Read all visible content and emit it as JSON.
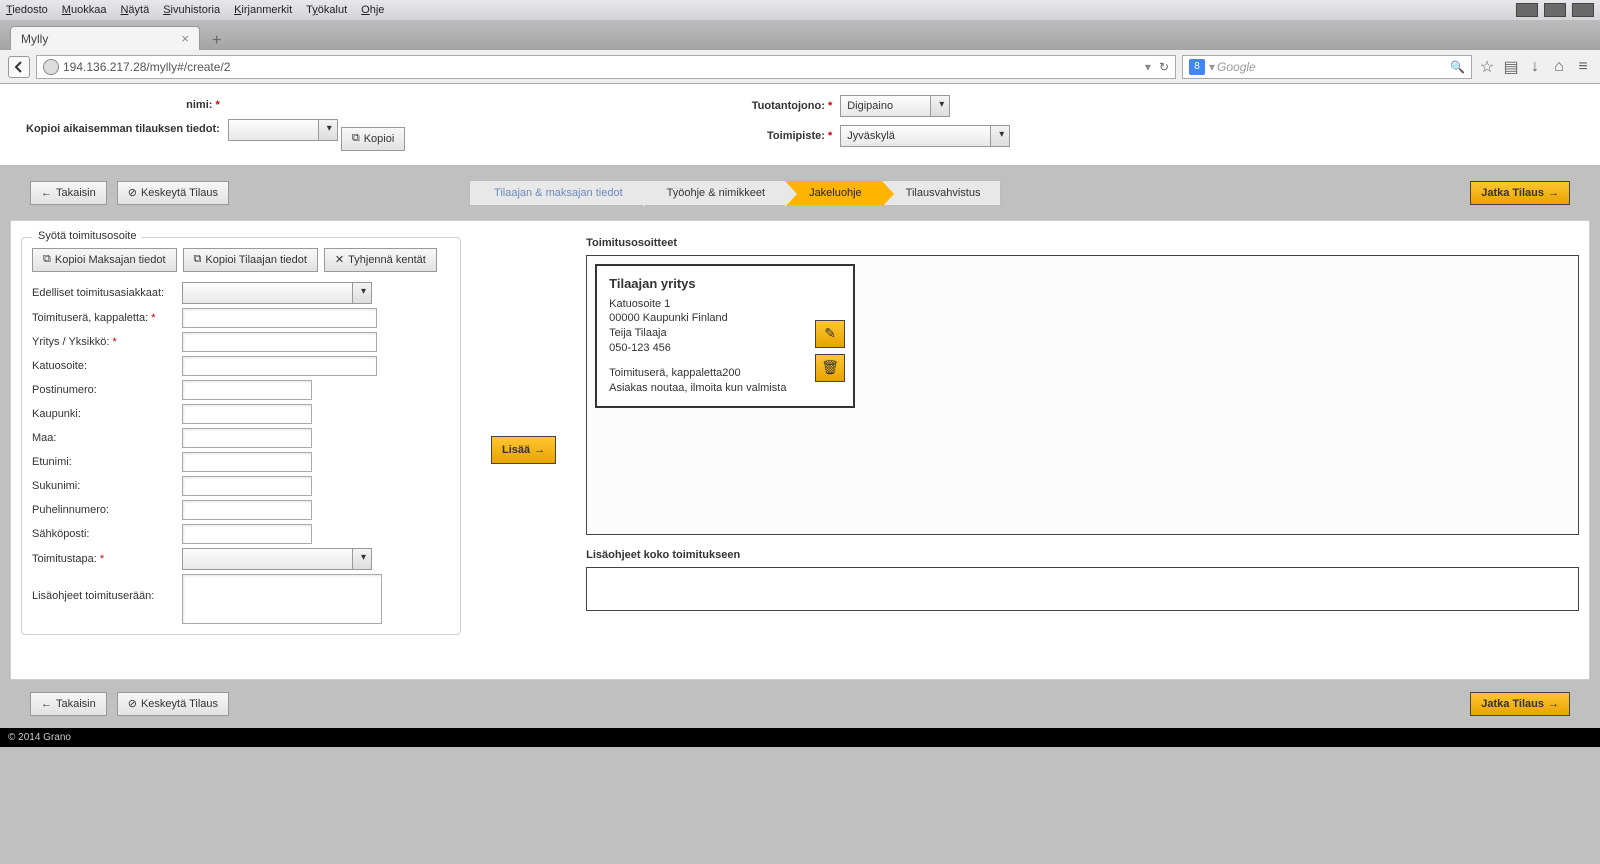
{
  "menubar": [
    "Tiedosto",
    "Muokkaa",
    "Näytä",
    "Sivuhistoria",
    "Kirjanmerkit",
    "Työkalut",
    "Ohje"
  ],
  "tab_title": "Mylly",
  "url": "194.136.217.28/mylly#/create/2",
  "search_placeholder": "Google",
  "top": {
    "nimi_label": "nimi:",
    "kopioi_aik_label": "Kopioi aikaisemman tilauksen tiedot:",
    "kopioi_btn": "Kopioi",
    "tuotantojono_label": "Tuotantojono:",
    "tuotantojono_value": "Digipaino",
    "toimipiste_label": "Toimipiste:",
    "toimipiste_value": "Jyväskylä"
  },
  "actions": {
    "back": "Takaisin",
    "cancel": "Keskeytä Tilaus",
    "continue": "Jatka Tilaus"
  },
  "wizard": [
    {
      "label": "Tilaajan & maksajan tiedot",
      "state": "done"
    },
    {
      "label": "Työohje & nimikkeet",
      "state": "norm"
    },
    {
      "label": "Jakeluohje",
      "state": "active"
    },
    {
      "label": "Tilausvahvistus",
      "state": "norm"
    }
  ],
  "leftform": {
    "title": "Syötä toimitusosoite",
    "btn_kopioi_maksajan": "Kopioi Maksajan tiedot",
    "btn_kopioi_tilaajan": "Kopioi Tilaajan tiedot",
    "btn_tyhjenna": "Tyhjennä kentät",
    "fields": {
      "edelliset": "Edelliset toimitusasiakkaat:",
      "toimitusera": "Toimituserä, kappaletta:",
      "yritys": "Yritys / Yksikkö:",
      "katuosoite": "Katuosoite:",
      "postinumero": "Postinumero:",
      "kaupunki": "Kaupunki:",
      "maa": "Maa:",
      "etunimi": "Etunimi:",
      "sukunimi": "Sukunimi:",
      "puhelin": "Puhelinnumero:",
      "sahkoposti": "Sähköposti:",
      "toimitustapa": "Toimitustapa:",
      "lisaohjeet": "Lisäohjeet toimituserään:"
    }
  },
  "add_btn": "Lisää",
  "right": {
    "title": "Toimitusosoitteet",
    "card": {
      "heading": "Tilaajan yritys",
      "l1": "Katuosoite 1",
      "l2": "00000 Kaupunki Finland",
      "l3": "Teija Tilaaja",
      "l4": "050-123 456",
      "l5": "Toimituserä, kappaletta200",
      "l6": "Asiakas noutaa, ilmoita kun valmista"
    },
    "extra_title": "Lisäohjeet koko toimitukseen"
  },
  "footer": "© 2014 Grano"
}
